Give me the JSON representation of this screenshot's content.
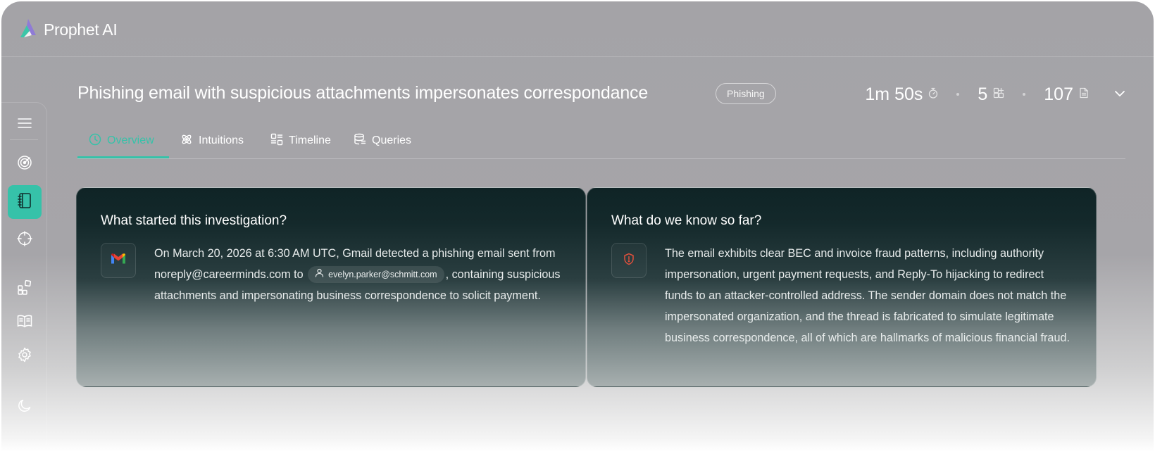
{
  "brand": {
    "name": "Prophet AI"
  },
  "case": {
    "title": "Phishing email with suspicious attachments impersonates correspondance",
    "tag": "Phishing",
    "stats": [
      {
        "value": "1m 50s",
        "icon": "stopwatch-icon"
      },
      {
        "value": "5",
        "icon": "grid-plus-icon"
      },
      {
        "value": "107",
        "icon": "document-icon"
      }
    ]
  },
  "tabs": [
    {
      "label": "Overview",
      "icon": "clock-icon",
      "active": true
    },
    {
      "label": "Intuitions",
      "icon": "atom-icon"
    },
    {
      "label": "Timeline",
      "icon": "timeline-icon"
    },
    {
      "label": "Queries",
      "icon": "database-icon"
    }
  ],
  "sidebar": [
    "menu-icon",
    "radar-icon",
    "notebook-icon",
    "crosshair-icon",
    "widgets-icon",
    "book-icon",
    "gear-icon",
    "moon-icon"
  ],
  "cards": {
    "started": {
      "title": "What started this investigation?",
      "text_before": "On March 20, 2026 at 6:30 AM UTC, Gmail detected a phishing email sent from noreply@careerminds.com to",
      "chip": "evelyn.parker@schmitt.com",
      "text_after": ", containing suspicious attachments and impersonating business correspondence to solicit payment."
    },
    "known": {
      "title": "What do we know so far?",
      "text": "The email exhibits clear BEC and invoice fraud patterns, including authority impersonation, urgent payment requests, and Reply-To hijacking to redirect funds to an attacker-controlled address. The sender domain does not match the impersonated organization, and the thread is fabricated to simulate legitimate business correspondence, all of which are hallmarks of malicious financial fraud."
    }
  },
  "colors": {
    "accent": "#36c2a9",
    "card_dark": "#0f2426",
    "alert": "#e0503c"
  }
}
